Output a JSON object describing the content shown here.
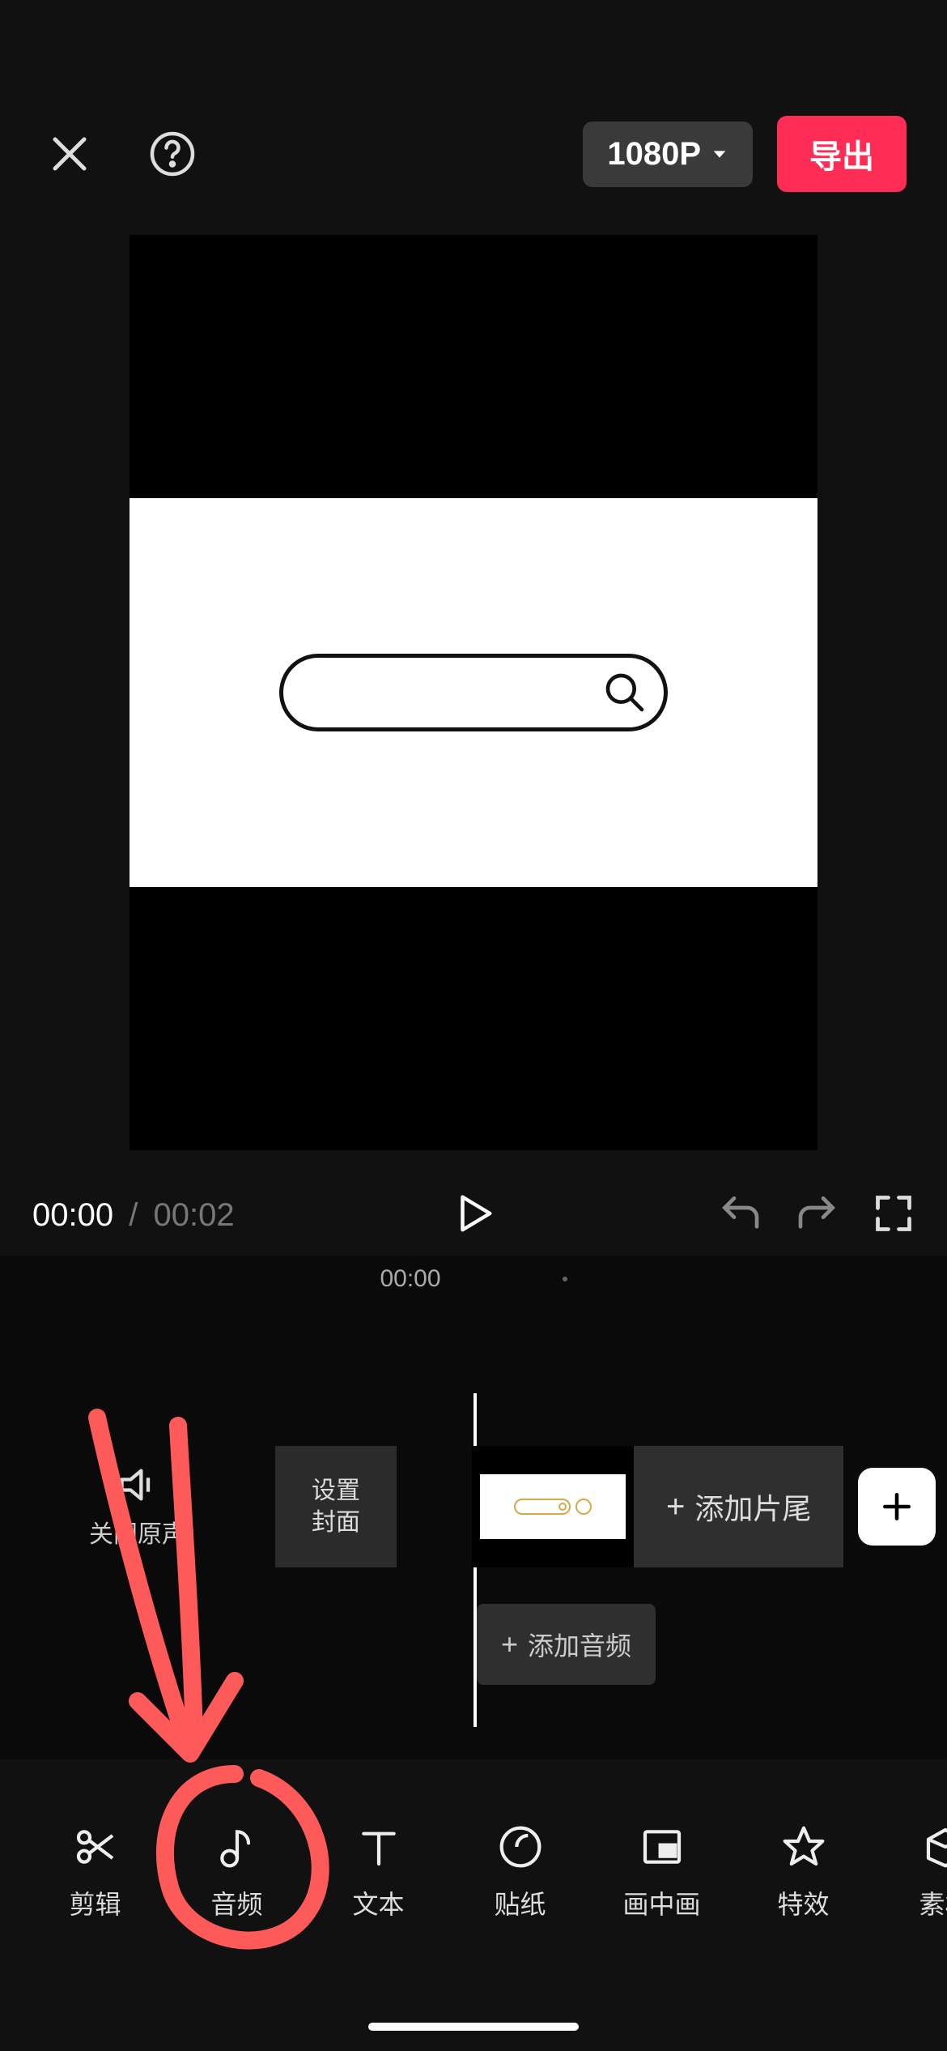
{
  "topbar": {
    "resolution_label": "1080P",
    "export_label": "导出"
  },
  "playback": {
    "current_time": "00:00",
    "separator": "/",
    "duration": "00:02"
  },
  "timeline": {
    "ruler_label": "00:00",
    "mute_label": "关闭原声",
    "cover_label": "设置\n封面",
    "ending_label": "添加片尾",
    "add_audio_label": "添加音频"
  },
  "toolbar": {
    "items": [
      {
        "icon": "scissors",
        "label": "剪辑"
      },
      {
        "icon": "music-note",
        "label": "音频"
      },
      {
        "icon": "text",
        "label": "文本"
      },
      {
        "icon": "sticker",
        "label": "贴纸"
      },
      {
        "icon": "pip",
        "label": "画中画"
      },
      {
        "icon": "effects",
        "label": "特效"
      },
      {
        "icon": "materials",
        "label": "素材"
      }
    ]
  }
}
